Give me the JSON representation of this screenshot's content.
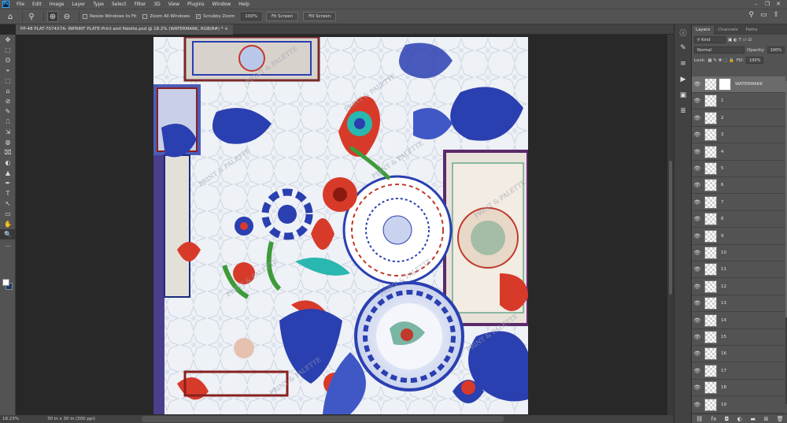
{
  "menu": {
    "items": [
      "File",
      "Edit",
      "Image",
      "Layer",
      "Type",
      "Select",
      "Filter",
      "3D",
      "View",
      "Plugins",
      "Window",
      "Help"
    ],
    "logo": "Ps"
  },
  "window_controls": [
    "–",
    "❐",
    "✕"
  ],
  "options": {
    "zoom_in_icon": "zoom-in-icon",
    "zoom_out_icon": "zoom-out-icon",
    "resize_windows": "Resize Windows to Fit",
    "zoom_all": "Zoom All Windows",
    "scrubby": "Scrubby Zoom",
    "zoom_field": "100%",
    "fit_screen": "Fit Screen",
    "fill_screen": "Fill Screen"
  },
  "document": {
    "tab_title": "PP-48 PLAT-7074X7A- INPRINT PLATE-Print and Palette.psd @ 18.2% (WATERMARK, RGB/8#) *",
    "close": "×"
  },
  "status": {
    "zoom": "18.23%",
    "doc_info": "30 in x 30 in (300 ppi)"
  },
  "tools": [
    "✥",
    "⬚",
    "ʘ",
    "⌖",
    "⬚",
    "⌂",
    "⊘",
    "✎",
    "⎍",
    "⇲",
    "◍",
    "⌧",
    "◐",
    "▲",
    "✒",
    "T",
    "↖",
    "▭",
    "✋",
    "🔍"
  ],
  "panel_strip": [
    "ⓘ",
    "✎",
    "≡",
    "▶",
    "▣",
    "≣"
  ],
  "layers_panel": {
    "tabs": [
      "Layers",
      "Channels",
      "Paths"
    ],
    "kind": "Kind",
    "blend": "Normal",
    "opacity_label": "Opacity:",
    "opacity": "100%",
    "lock_label": "Lock:",
    "fill_label": "Fill:",
    "fill": "100%",
    "layers": [
      {
        "name": "WATERMARK",
        "mask": true
      },
      {
        "name": "1"
      },
      {
        "name": "2"
      },
      {
        "name": "3"
      },
      {
        "name": "4"
      },
      {
        "name": "5"
      },
      {
        "name": "6"
      },
      {
        "name": "7"
      },
      {
        "name": "8"
      },
      {
        "name": "9"
      },
      {
        "name": "10"
      },
      {
        "name": "11"
      },
      {
        "name": "12"
      },
      {
        "name": "13"
      },
      {
        "name": "14"
      },
      {
        "name": "15"
      },
      {
        "name": "16"
      },
      {
        "name": "17"
      },
      {
        "name": "18"
      },
      {
        "name": "19"
      }
    ],
    "bottom_icons": [
      "⛓",
      "fx",
      "◘",
      "◐",
      "▬",
      "⊞",
      "🗑"
    ]
  },
  "artwork": {
    "watermark_text": "PRINT & PALETTE",
    "colors": {
      "blue": "#2a3fb0",
      "navy": "#1b2a80",
      "red": "#d83a2a",
      "teal": "#2ab7b0",
      "green": "#3f9a3a",
      "bg": "#eef1f6"
    }
  }
}
